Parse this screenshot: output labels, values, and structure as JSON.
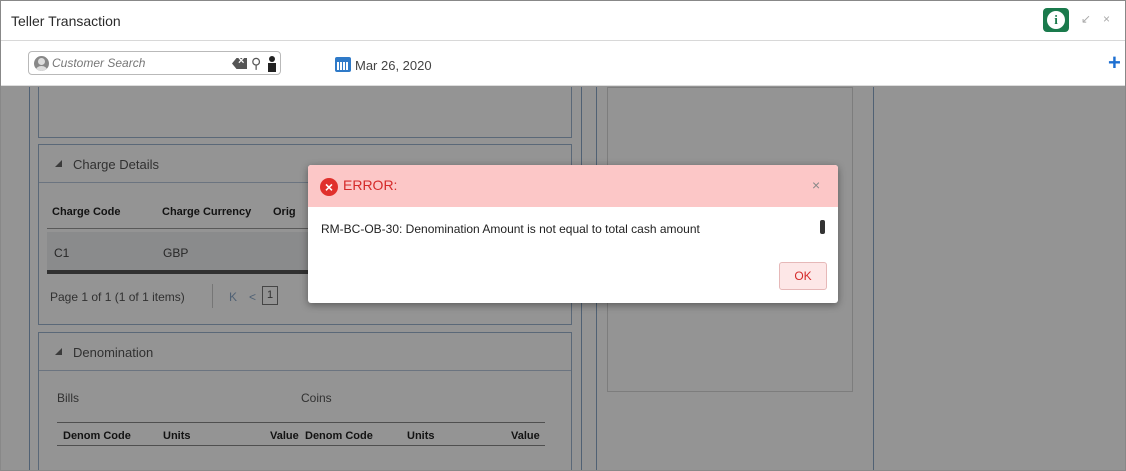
{
  "window": {
    "title": "Teller Transaction"
  },
  "toolbar": {
    "search_placeholder": "Customer Search",
    "date": "Mar 26, 2020"
  },
  "charge_details": {
    "section_label": "Charge Details",
    "columns": [
      "Charge Code",
      "Charge Currency",
      "Orig"
    ],
    "rows": [
      {
        "code": "C1",
        "currency": "GBP"
      }
    ],
    "pager": {
      "text": "Page  1  of 1  (1 of 1 items)",
      "first": "K",
      "prev": "<",
      "current_page": "1"
    }
  },
  "denomination": {
    "section_label": "Denomination",
    "bills_label": "Bills",
    "coins_label": "Coins",
    "bills_columns": [
      "Denom Code",
      "Units",
      "Value"
    ],
    "coins_columns": [
      "Denom Code",
      "Units",
      "Value"
    ]
  },
  "error_dialog": {
    "title": "ERROR:",
    "close_glyph": "×",
    "message_code": "RM-BC-OB-30",
    "message_text": ": Denomination Amount is not equal to total cash amount",
    "ok_label": "OK"
  },
  "colors": {
    "dialog_header": "#fcc7c7",
    "error_red": "#d52a2a",
    "info_green": "#1a7a4c",
    "accent_blue": "#1d6fd1"
  }
}
